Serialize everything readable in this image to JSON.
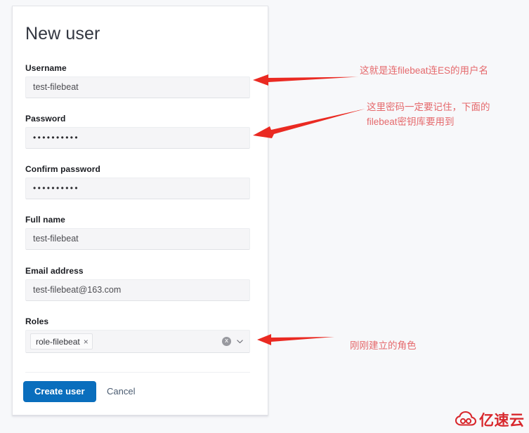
{
  "form": {
    "title": "New user",
    "fields": [
      {
        "label": "Username",
        "value": "test-filebeat",
        "type": "text"
      },
      {
        "label": "Password",
        "value": "••••••••••",
        "type": "password"
      },
      {
        "label": "Confirm password",
        "value": "••••••••••",
        "type": "password"
      },
      {
        "label": "Full name",
        "value": "test-filebeat",
        "type": "text"
      },
      {
        "label": "Email address",
        "value": "test-filebeat@163.com",
        "type": "text"
      }
    ],
    "roles": {
      "label": "Roles",
      "selected": "role-filebeat",
      "pill_remove_icon": "×",
      "clear_icon": "x",
      "dropdown_icon": "chevron-down-icon"
    },
    "actions": {
      "submit_label": "Create user",
      "cancel_label": "Cancel"
    }
  },
  "annotations": [
    {
      "text": "这就是连filebeat连ES的用户名",
      "target": "username-field"
    },
    {
      "text": "这里密码一定要记住，下面的\nfilebeat密钥库要用到",
      "target": "password-field"
    },
    {
      "text": "刚刚建立的角色",
      "target": "roles-field"
    }
  ],
  "watermark": {
    "text": "亿速云",
    "logo_icon": "cloud-logo-icon"
  },
  "colors": {
    "accent": "#0a6ebd",
    "annotation": "#e5696c",
    "arrow": "#ea2a22",
    "watermark": "#d8272c",
    "page_background": "#f7f8fa",
    "card_background": "#ffffff"
  }
}
